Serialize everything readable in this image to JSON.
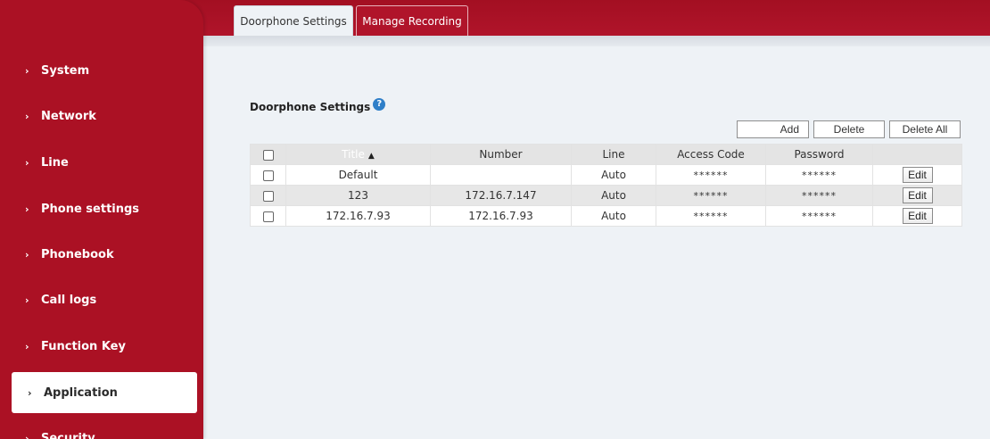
{
  "sidebar": {
    "items": [
      {
        "label": "System"
      },
      {
        "label": "Network"
      },
      {
        "label": "Line"
      },
      {
        "label": "Phone settings"
      },
      {
        "label": "Phonebook"
      },
      {
        "label": "Call logs"
      },
      {
        "label": "Function Key"
      },
      {
        "label": "Application",
        "active": true
      },
      {
        "label": "Security"
      }
    ],
    "chevron": "›"
  },
  "tabs": [
    {
      "label": "Doorphone Settings",
      "active": true
    },
    {
      "label": "Manage Recording",
      "active": false
    }
  ],
  "section": {
    "title": "Doorphone Settings",
    "help_icon": "question-circle-icon",
    "help_glyph": "?"
  },
  "actions": {
    "add": "Add",
    "delete": "Delete",
    "delete_all": "Delete All"
  },
  "table": {
    "columns": [
      "",
      "Title",
      "Number",
      "Line",
      "Access Code",
      "Password",
      ""
    ],
    "sort_indicator": "▲",
    "rows": [
      {
        "title": "Default",
        "number": "",
        "line": "Auto",
        "access_code": "******",
        "password": "******",
        "action": "Edit"
      },
      {
        "title": "123",
        "number": "172.16.7.147",
        "line": "Auto",
        "access_code": "******",
        "password": "******",
        "action": "Edit"
      },
      {
        "title": "172.16.7.93",
        "number": "172.16.7.93",
        "line": "Auto",
        "access_code": "******",
        "password": "******",
        "action": "Edit"
      }
    ]
  },
  "colors": {
    "brand_red": "#ab1124",
    "content_bg": "#eef2f6",
    "help_blue": "#2f7fc8"
  }
}
